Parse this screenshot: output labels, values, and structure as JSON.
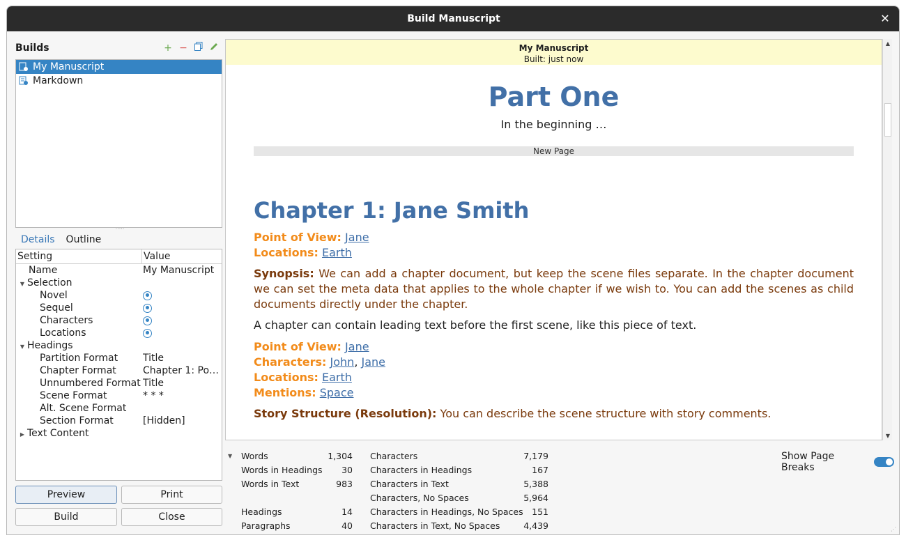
{
  "window": {
    "title": "Build Manuscript"
  },
  "builds": {
    "title": "Builds",
    "items": [
      {
        "label": "My Manuscript",
        "selected": true
      },
      {
        "label": "Markdown",
        "selected": false
      }
    ]
  },
  "tabs": [
    {
      "label": "Details"
    },
    {
      "label": "Outline"
    }
  ],
  "settings": {
    "col_setting": "Setting",
    "col_value": "Value",
    "name": {
      "label": "Name",
      "value": "My Manuscript"
    },
    "selection": {
      "label": "Selection"
    },
    "novel": {
      "label": "Novel"
    },
    "sequel": {
      "label": "Sequel"
    },
    "characters": {
      "label": "Characters"
    },
    "locations": {
      "label": "Locations"
    },
    "headings": {
      "label": "Headings"
    },
    "partition": {
      "label": "Partition Format",
      "value": "Title"
    },
    "chapter": {
      "label": "Chapter Format",
      "value": "Chapter 1: Poi…"
    },
    "unnumbered": {
      "label": "Unnumbered Format",
      "value": "Title"
    },
    "scene": {
      "label": "Scene Format",
      "value": "* * *"
    },
    "altscene": {
      "label": "Alt. Scene Format",
      "value": ""
    },
    "section": {
      "label": "Section Format",
      "value": "[Hidden]"
    },
    "textcontent": {
      "label": "Text Content"
    }
  },
  "buttons": {
    "preview": "Preview",
    "print": "Print",
    "build": "Build",
    "close": "Close"
  },
  "preview": {
    "banner_name": "My Manuscript",
    "banner_built": "Built: just now",
    "part_title": "Part One",
    "part_sub": "In the beginning …",
    "newpage": "New Page",
    "chapter_title": "Chapter 1: Jane Smith",
    "pov1_key": "Point of View:",
    "pov1_val": "Jane",
    "loc1_key": "Locations:",
    "loc1_val": "Earth",
    "synopsis_key": "Synopsis:",
    "synopsis_text": "We can add a chapter document, but keep the scene files separate. In the chapter document we can set the meta data that applies to the whole chapter if we wish to. You can add the scenes as child documents directly under the chapter.",
    "para": "A chapter can contain leading text before the first scene, like this piece of text.",
    "pov2_key": "Point of View:",
    "pov2_val": "Jane",
    "char_key": "Characters:",
    "char_val1": "John",
    "char_sep": ",",
    "char_val2": "Jane",
    "loc2_key": "Locations:",
    "loc2_val": "Earth",
    "ment_key": "Mentions:",
    "ment_val": "Space",
    "struct_key": "Story Structure (Resolution):",
    "struct_text": "You can describe the scene structure with story comments."
  },
  "stats": {
    "words": {
      "label": "Words",
      "value": "1,304"
    },
    "words_headings": {
      "label": "Words in Headings",
      "value": "30"
    },
    "words_text": {
      "label": "Words in Text",
      "value": "983"
    },
    "headings": {
      "label": "Headings",
      "value": "14"
    },
    "paragraphs": {
      "label": "Paragraphs",
      "value": "40"
    },
    "chars": {
      "label": "Characters",
      "value": "7,179"
    },
    "chars_headings": {
      "label": "Characters in Headings",
      "value": "167"
    },
    "chars_text": {
      "label": "Characters in Text",
      "value": "5,388"
    },
    "chars_nospace": {
      "label": "Characters, No Spaces",
      "value": "5,964"
    },
    "chars_headings_ns": {
      "label": "Characters in Headings, No Spaces",
      "value": "151"
    },
    "chars_text_ns": {
      "label": "Characters in Text, No Spaces",
      "value": "4,439"
    },
    "show_page_breaks": "Show Page Breaks"
  },
  "colors": {
    "accent": "#3584c4",
    "heading": "#4270a7",
    "meta_key": "#f28b1a",
    "synopsis": "#7a3a0c",
    "banner": "#fdfbce"
  }
}
